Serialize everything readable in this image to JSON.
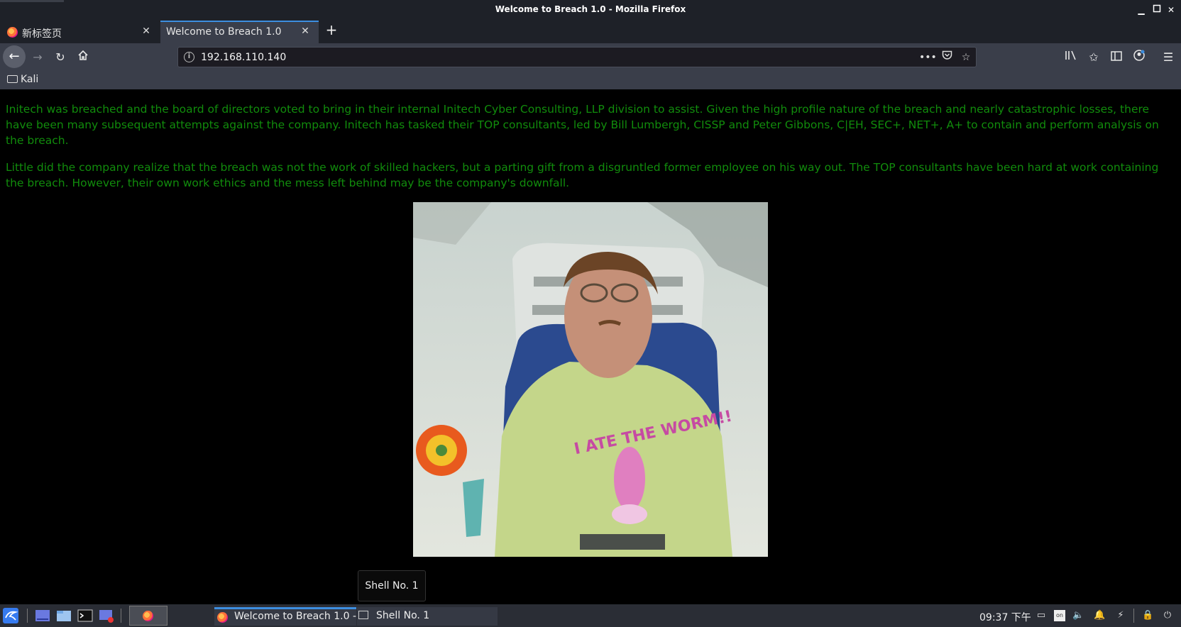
{
  "window": {
    "title": "Welcome to Breach 1.0 - Mozilla Firefox"
  },
  "tabs": [
    {
      "label": "新标签页",
      "active": false
    },
    {
      "label": "Welcome to Breach 1.0",
      "active": true
    }
  ],
  "navbar": {
    "url": "192.168.110.140"
  },
  "bookmarks": [
    {
      "label": "Kali"
    }
  ],
  "page": {
    "paragraphs": [
      "Initech was breached and the board of directors voted to bring in their internal Initech Cyber Consulting, LLP division to assist. Given the high profile nature of the breach and nearly catastrophic losses, there have been many subsequent attempts against the company. Initech has tasked their TOP consultants, led by Bill Lumbergh, CISSP and Peter Gibbons, C|EH, SEC+, NET+, A+ to contain and perform analysis on the breach.",
      "Little did the company realize that the breach was not the work of skilled hackers, but a parting gift from a disgruntled former employee on his way out. The TOP consultants have been hard at work containing the breach. However, their own work ethics and the mess left behind may be the company's downfall."
    ],
    "text_color": "#118c0c",
    "shirt_text": "I ATE THE WORM!!"
  },
  "tooltip": {
    "text": "Shell No. 1"
  },
  "taskbar": {
    "tasks": [
      {
        "label": "Welcome to Breach 1.0 -..."
      },
      {
        "label": "Shell No. 1"
      }
    ],
    "clock": "09:37 下午",
    "accent": "#3d8ee0"
  }
}
